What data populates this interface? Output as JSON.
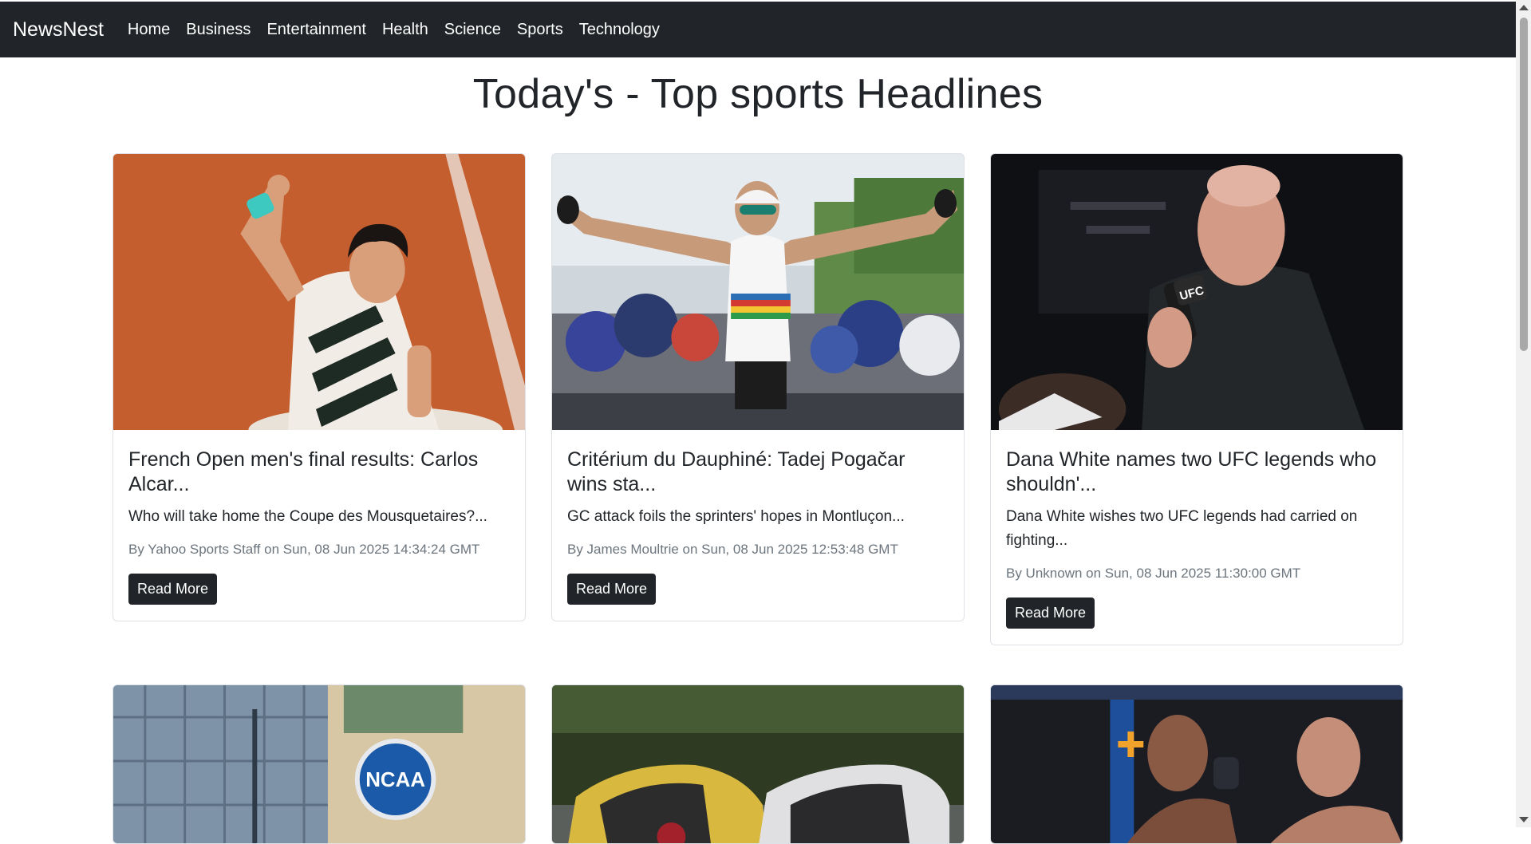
{
  "navbar": {
    "brand": "NewsNest",
    "links": [
      "Home",
      "Business",
      "Entertainment",
      "Health",
      "Science",
      "Sports",
      "Technology"
    ]
  },
  "page": {
    "title": "Today's - Top sports Headlines"
  },
  "cards": [
    {
      "title": "French Open men's final results: Carlos Alcar...",
      "text": "Who will take home the Coupe des Mousquetaires?...",
      "meta": "By Yahoo Sports Staff on Sun, 08 Jun 2025 14:34:24 GMT",
      "button": "Read More"
    },
    {
      "title": "Critérium du Dauphiné: Tadej Pogačar wins sta...",
      "text": "GC attack foils the sprinters' hopes in Montluçon...",
      "meta": "By James Moultrie on Sun, 08 Jun 2025 12:53:48 GMT",
      "button": "Read More"
    },
    {
      "title": "Dana White names two UFC legends who shouldn'...",
      "text": "Dana White wishes two UFC legends had carried on fighting...",
      "meta": "By Unknown on Sun, 08 Jun 2025 11:30:00 GMT",
      "button": "Read More"
    }
  ],
  "image_text": {
    "ncaa": "NCAA",
    "ufc_mic": "UFC"
  },
  "colors": {
    "navbar": "#212529",
    "button": "#212529",
    "clay": "#c8622f",
    "ncaa_blue": "#1a5aa8"
  }
}
